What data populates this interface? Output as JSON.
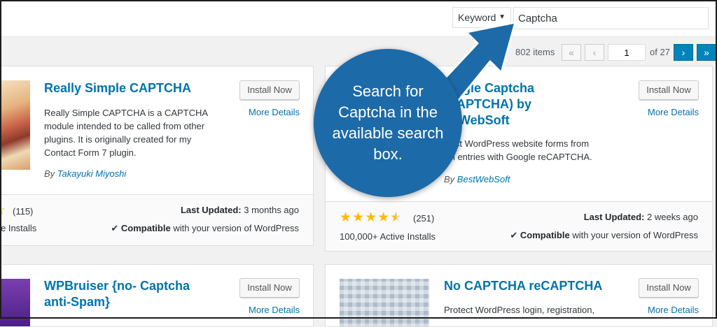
{
  "search": {
    "type_label": "Keyword",
    "value": "Captcha"
  },
  "pagination": {
    "items": "802 items",
    "first": "«",
    "prev": "‹",
    "page": "1",
    "of": "of 27",
    "next": "›",
    "last": "»"
  },
  "callout": {
    "text": "Search for Captcha in the available search box."
  },
  "plugins": [
    {
      "title": "Really Simple CAPTCHA",
      "description": "Really Simple CAPTCHA is a CAPTCHA module intended to be called from other plugins. It is originally created for my Contact Form 7 plugin.",
      "author_prefix": "By ",
      "author": "Takayuki Miyoshi",
      "install_label": "Install Now",
      "details_label": "More Details",
      "rating_count": "(115)",
      "installs": "e Installs",
      "last_updated_label": "Last Updated:",
      "last_updated": " 3 months ago",
      "compatible_label": "Compatible",
      "compatible_text": " with your version of WordPress",
      "check": "✔"
    },
    {
      "title_line1": "oogle Captcha",
      "title_line2": "CAPTCHA) by",
      "title_line3": "stWebSoft",
      "description_line1": "tect WordPress website forms from",
      "description_line2": "m entries with Google reCAPTCHA.",
      "author_prefix": "By ",
      "author": "BestWebSoft",
      "install_label": "Install Now",
      "details_label": "More Details",
      "rating": 4,
      "rating_count": "(251)",
      "installs": "100,000+ Active Installs",
      "last_updated_label": "Last Updated:",
      "last_updated": " 2 weeks ago",
      "compatible_label": "Compatible",
      "compatible_text": " with your version of WordPress",
      "check": "✔"
    },
    {
      "title_line1": "WPBruiser {no- Captcha",
      "title_line2": "anti-Spam}",
      "install_label": "Install Now",
      "details_label": "More Details"
    },
    {
      "title": "No CAPTCHA reCAPTCHA",
      "description": "Protect WordPress login, registration,",
      "install_label": "Install Now",
      "details_label": "More Details"
    }
  ],
  "colors": {
    "link": "#0073aa",
    "star": "#ffb900",
    "callout": "#1d6aa8",
    "active_page": "#0085ba"
  }
}
